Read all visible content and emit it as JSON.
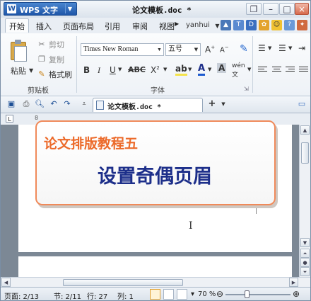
{
  "titlebar": {
    "app_name": "WPS 文字",
    "app_logo": "W",
    "document_title": "论文模板.doc *"
  },
  "menu": {
    "tabs": [
      "开始",
      "插入",
      "页面布局",
      "引用",
      "审阅",
      "视图"
    ],
    "user": "yanhui"
  },
  "ribbon": {
    "clipboard": {
      "paste": "粘贴",
      "cut": "剪切",
      "copy": "复制",
      "format_painter": "格式刷",
      "group_label": "剪贴板"
    },
    "font": {
      "family": "Times New Roman",
      "size": "五号",
      "group_label": "字体"
    }
  },
  "doctab": {
    "label": "论文模板.doc *"
  },
  "ruler": {
    "mark": "8"
  },
  "overlay": {
    "subtitle": "论文排版教程五",
    "title": "设置奇偶页眉"
  },
  "status": {
    "page": "页面: 2/13",
    "section": "节: 2/11",
    "line": "行: 27",
    "column": "列: 1",
    "zoom": "70 %"
  },
  "colors": {
    "accent_orange": "#ec6a2a",
    "title_blue": "#1d2f8a",
    "app_blue": "#1e56a8"
  }
}
